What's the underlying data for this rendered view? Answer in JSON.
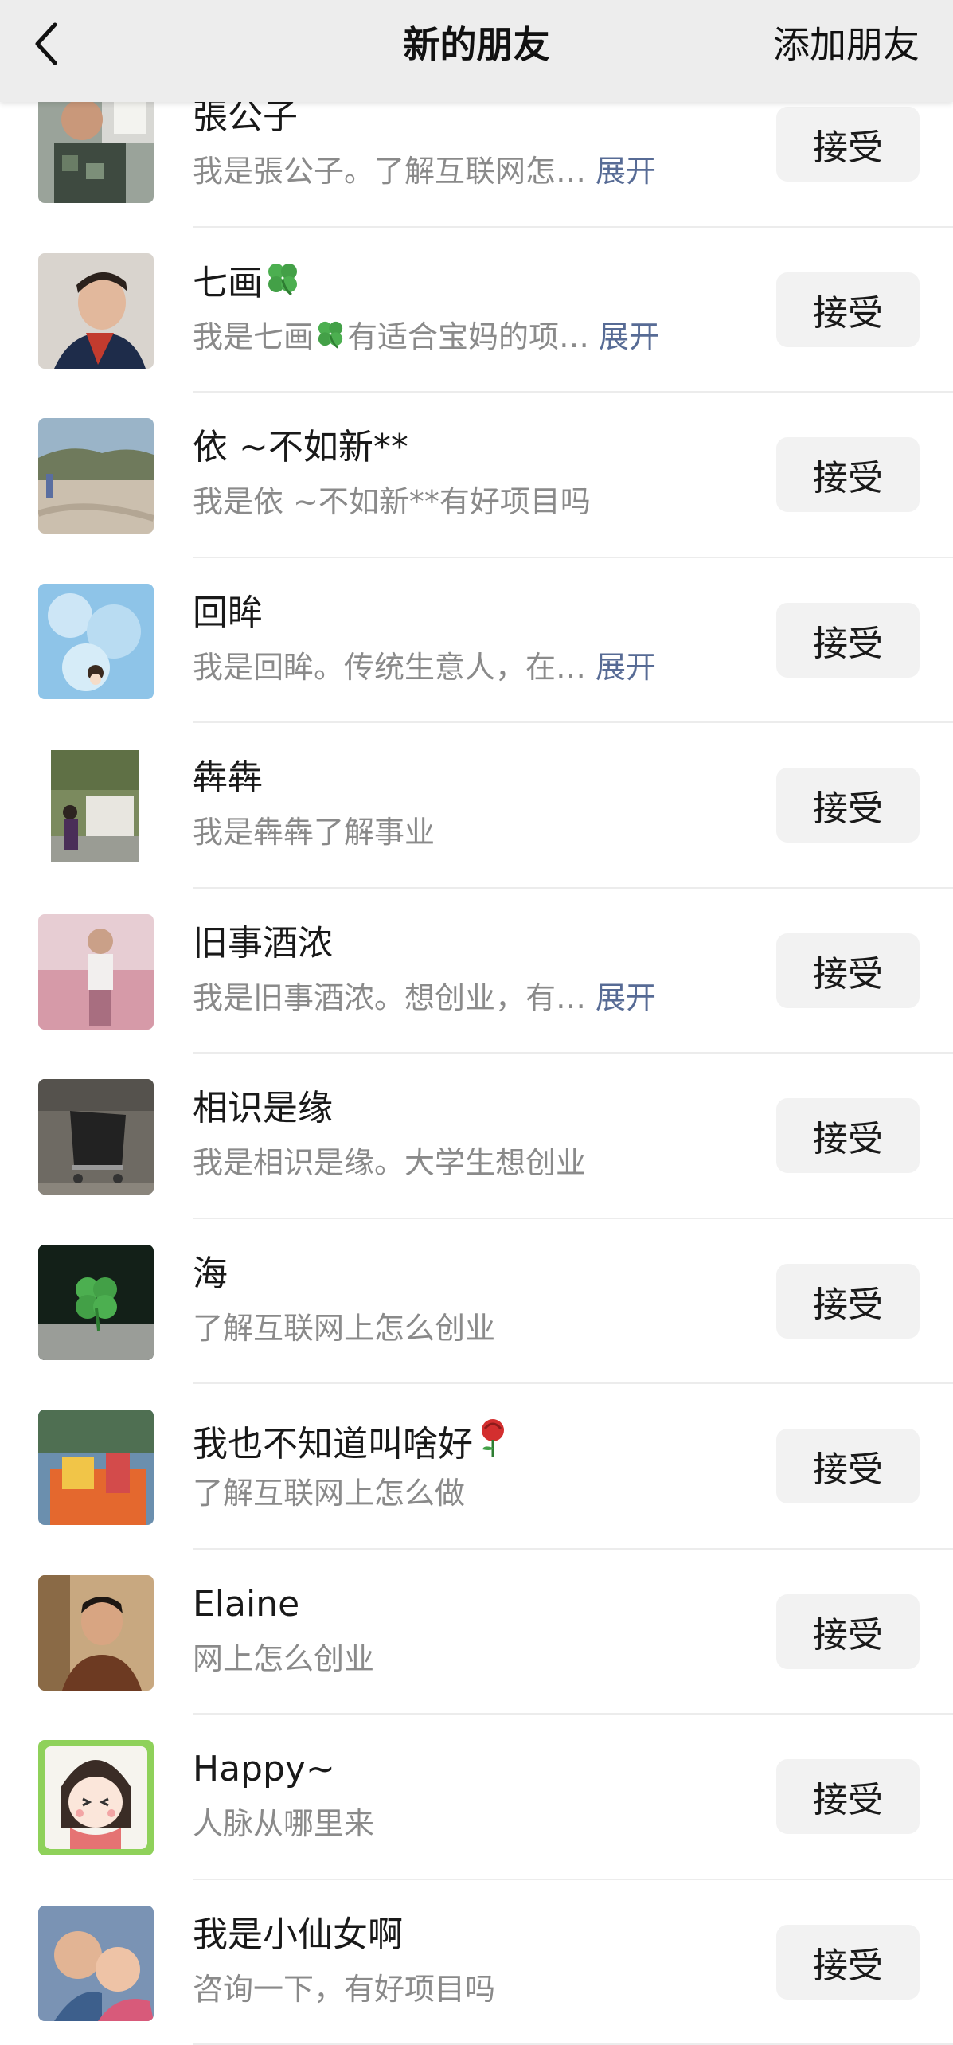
{
  "header": {
    "title": "新的朋友",
    "action_label": "添加朋友",
    "back_icon": "chevron-left-icon"
  },
  "accent_colors": {
    "link": "#576b95",
    "secondary_text": "#8a8a8a",
    "header_bg": "#ededed",
    "button_bg": "#f2f2f2"
  },
  "expand_label": "展开",
  "accept_label": "接受",
  "requests": [
    {
      "name": "張公子",
      "message": "我是張公子。了解互联网怎…",
      "expandable": true
    },
    {
      "name": "七画",
      "name_emoji": "four-leaf-clover-icon",
      "message": "我是七画",
      "message_emoji": "four-leaf-clover-icon",
      "message_tail": "有适合宝妈的项…",
      "expandable": true
    },
    {
      "name": "依 ~不如新**",
      "message": "我是依 ~不如新**有好项目吗",
      "expandable": false
    },
    {
      "name": "回眸",
      "message": "我是回眸。传统生意人，在…",
      "expandable": true
    },
    {
      "name": "犇犇",
      "message": "我是犇犇了解事业",
      "expandable": false
    },
    {
      "name": "旧事酒浓",
      "message": "我是旧事酒浓。想创业，有…",
      "expandable": true
    },
    {
      "name": "相识是缘",
      "message": "我是相识是缘。大学生想创业",
      "expandable": false
    },
    {
      "name": "海",
      "message": "了解互联网上怎么创业",
      "expandable": false
    },
    {
      "name": "我也不知道叫啥好",
      "name_emoji": "rose-icon",
      "message": "了解互联网上怎么做",
      "expandable": false
    },
    {
      "name": "Elaine",
      "message": "网上怎么创业",
      "expandable": false
    },
    {
      "name": "Happy~",
      "message": "人脉从哪里来",
      "expandable": false
    },
    {
      "name": "我是小仙女啊",
      "message": "咨询一下，有好项目吗",
      "expandable": false
    }
  ]
}
